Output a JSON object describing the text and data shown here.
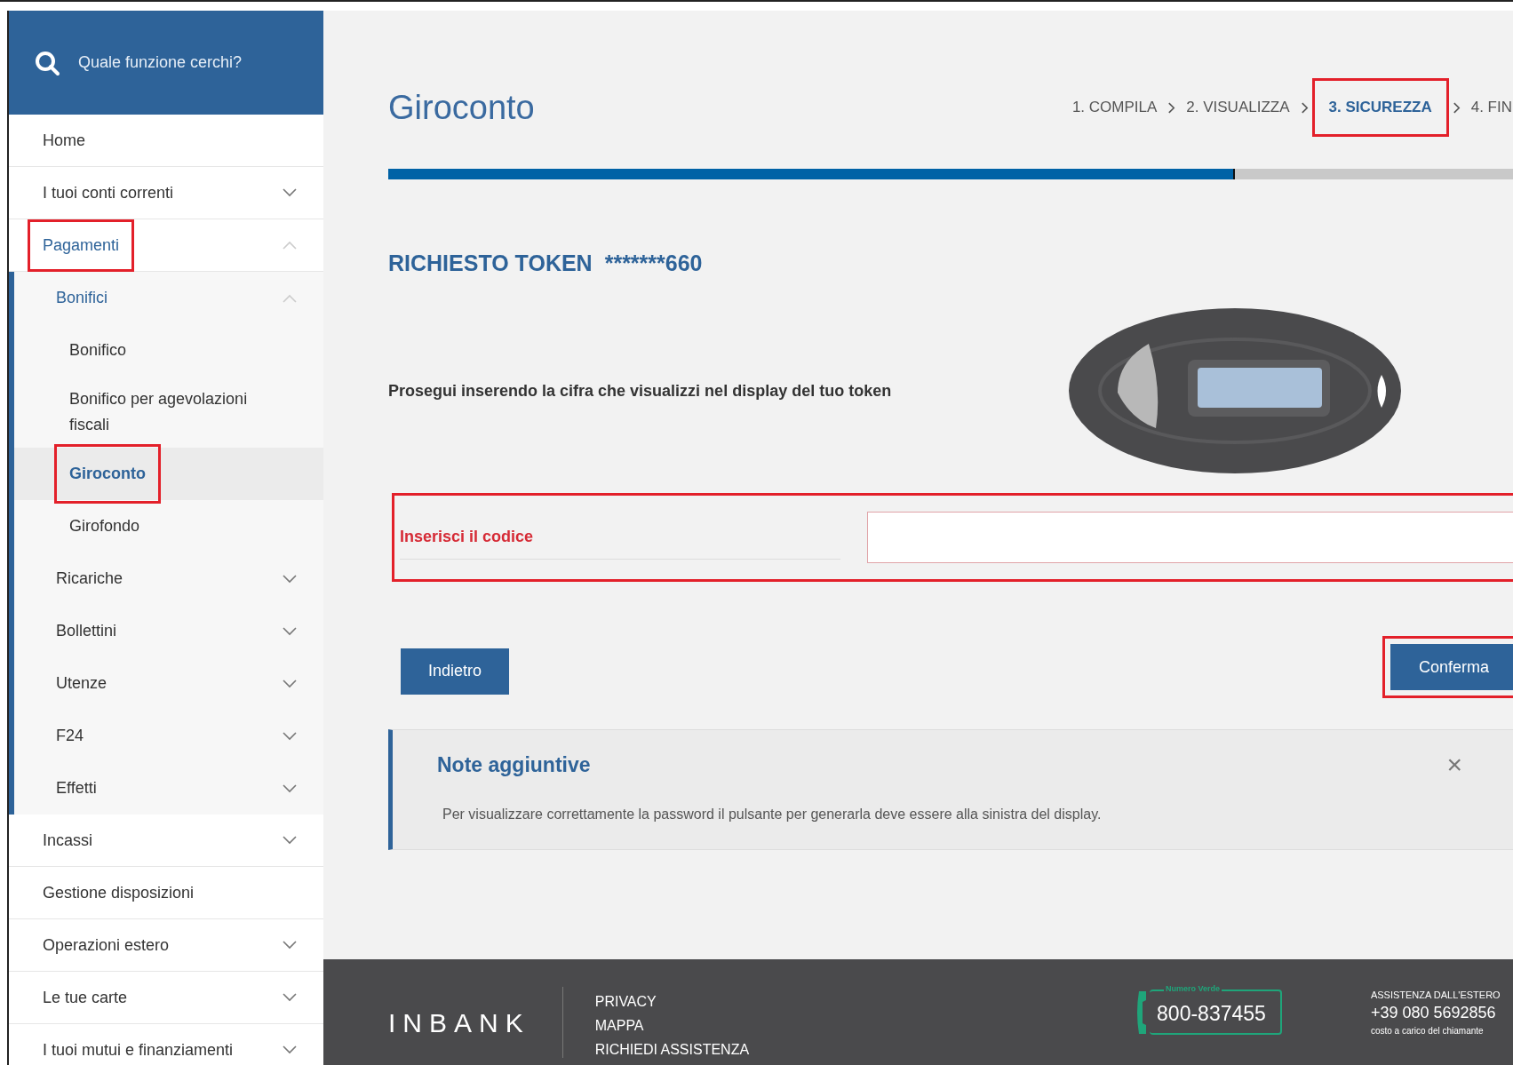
{
  "sidebar": {
    "search": {
      "placeholder": "Quale funzione cerchi?"
    },
    "items": [
      {
        "label": "Home",
        "kind": "link",
        "selected": false,
        "highlighted": false
      },
      {
        "label": "I tuoi conti correnti",
        "kind": "group",
        "expanded": false,
        "selected": false,
        "highlighted": false
      },
      {
        "label": "Pagamenti",
        "kind": "group",
        "expanded": true,
        "selected": false,
        "highlighted": true,
        "children": [
          {
            "label": "Bonifici",
            "kind": "group",
            "expanded": true,
            "selected": false,
            "highlighted": false,
            "children": [
              {
                "label": "Bonifico",
                "selected": false,
                "highlighted": false
              },
              {
                "label": "Bonifico per agevolazioni fiscali",
                "selected": false,
                "highlighted": false
              },
              {
                "label": "Giroconto",
                "selected": true,
                "highlighted": true
              },
              {
                "label": "Girofondo",
                "selected": false,
                "highlighted": false
              }
            ]
          },
          {
            "label": "Ricariche",
            "kind": "group",
            "expanded": false,
            "selected": false,
            "highlighted": false
          },
          {
            "label": "Bollettini",
            "kind": "group",
            "expanded": false,
            "selected": false,
            "highlighted": false
          },
          {
            "label": "Utenze",
            "kind": "group",
            "expanded": false,
            "selected": false,
            "highlighted": false
          },
          {
            "label": "F24",
            "kind": "group",
            "expanded": false,
            "selected": false,
            "highlighted": false
          },
          {
            "label": "Effetti",
            "kind": "group",
            "expanded": false,
            "selected": false,
            "highlighted": false
          }
        ]
      },
      {
        "label": "Incassi",
        "kind": "group",
        "expanded": false,
        "selected": false,
        "highlighted": false
      },
      {
        "label": "Gestione disposizioni",
        "kind": "link",
        "selected": false,
        "highlighted": false
      },
      {
        "label": "Operazioni estero",
        "kind": "group",
        "expanded": false,
        "selected": false,
        "highlighted": false
      },
      {
        "label": "Le tue carte",
        "kind": "group",
        "expanded": false,
        "selected": false,
        "highlighted": false
      },
      {
        "label": "I tuoi mutui e finanziamenti",
        "kind": "group",
        "expanded": false,
        "selected": false,
        "highlighted": false
      }
    ]
  },
  "page": {
    "title": "Giroconto",
    "steps": [
      {
        "label": "1. COMPILA",
        "selected": false,
        "highlighted": false
      },
      {
        "label": "2. VISUALIZZA",
        "selected": false,
        "highlighted": false
      },
      {
        "label": "3. SICUREZZA",
        "selected": true,
        "highlighted": true
      },
      {
        "label": "4. FIN",
        "selected": false,
        "highlighted": false
      }
    ],
    "progress": {
      "level": 0.75
    },
    "token_heading": "RICHIESTO TOKEN",
    "token_number": "*******660",
    "instruction": "Prosegui inserendo la cifra che visualizzi nel display del tuo token",
    "code_field": {
      "label": "Inserisci il codice",
      "highlighted": true
    },
    "back_button": {
      "label": "Indietro"
    },
    "confirm_button": {
      "label": "Conferma",
      "highlighted": true
    },
    "note": {
      "title": "Note aggiuntive",
      "close": "×",
      "text": "Per visualizzare correttamente la password il pulsante per generarla deve essere alla sinistra del display."
    }
  },
  "footer": {
    "logo": "INBANK",
    "links": [
      "PRIVACY",
      "MAPPA",
      "RICHIEDI ASSISTENZA"
    ],
    "toll_free": {
      "label": "Numero Verde",
      "number": "800-837455"
    },
    "abroad": {
      "title": "ASSISTENZA DALL'ESTERO",
      "number": "+39 080 5692856",
      "note": "costo a carico del chiamante"
    }
  }
}
